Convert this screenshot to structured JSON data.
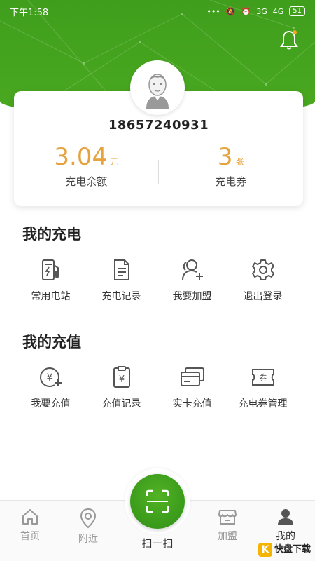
{
  "status_bar": {
    "time": "下午1:58",
    "signal_1": "3G",
    "signal_2": "4G",
    "battery": "51"
  },
  "header": {
    "bell_icon": "bell-icon"
  },
  "profile": {
    "avatar_icon": "avatar-icon",
    "phone": "18657240931",
    "balance": {
      "value": "3.04",
      "unit": "元",
      "label": "充电余额"
    },
    "coupons": {
      "value": "3",
      "unit": "张",
      "label": "充电券"
    }
  },
  "my_charging": {
    "title": "我的充电",
    "items": [
      {
        "label": "常用电站",
        "icon": "charging-station-icon"
      },
      {
        "label": "充电记录",
        "icon": "document-icon"
      },
      {
        "label": "我要加盟",
        "icon": "add-user-icon"
      },
      {
        "label": "退出登录",
        "icon": "settings-icon"
      }
    ]
  },
  "my_recharge": {
    "title": "我的充值",
    "items": [
      {
        "label": "我要充值",
        "icon": "yuan-add-icon"
      },
      {
        "label": "充值记录",
        "icon": "receipt-icon"
      },
      {
        "label": "实卡充值",
        "icon": "card-icon"
      },
      {
        "label": "充电券管理",
        "icon": "coupon-icon"
      }
    ]
  },
  "tabbar": {
    "home": "首页",
    "nearby": "附近",
    "scan": "扫一扫",
    "join": "加盟",
    "mine": "我的"
  },
  "watermark": {
    "logo_letter": "K",
    "text": "快盘下载"
  }
}
